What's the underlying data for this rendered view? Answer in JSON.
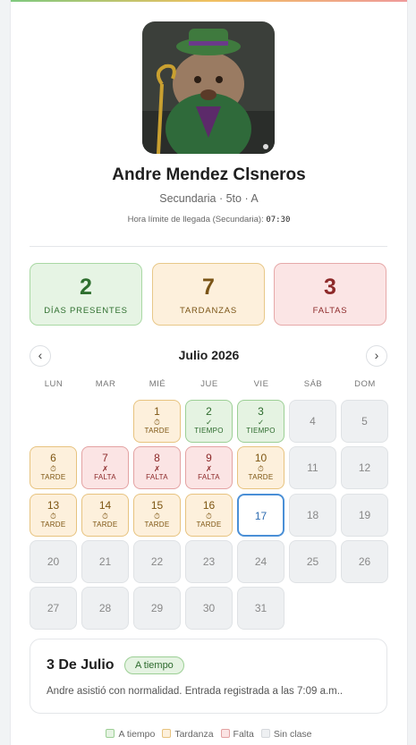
{
  "student": {
    "name": "Andre Mendez Clsneros",
    "info": "Secundaria · 5to · A",
    "limit_label": "Hora límite de llegada (Secundaria):",
    "limit_time": "07:30"
  },
  "stats": [
    {
      "value": "2",
      "label": "DÍAS PRESENTES"
    },
    {
      "value": "7",
      "label": "TARDANZAS"
    },
    {
      "value": "3",
      "label": "FALTAS"
    }
  ],
  "calendar": {
    "month": "Julio 2026",
    "prev_icon": "‹",
    "next_icon": "›",
    "weekdays": [
      "LUN",
      "MAR",
      "MIÉ",
      "JUE",
      "VIE",
      "SÁB",
      "DOM"
    ],
    "days": [
      {
        "n": "1",
        "status": "orange",
        "icon": "⏱",
        "label": "TARDE"
      },
      {
        "n": "2",
        "status": "green",
        "icon": "✓",
        "label": "TIEMPO"
      },
      {
        "n": "3",
        "status": "green",
        "icon": "✓",
        "label": "TIEMPO"
      },
      {
        "n": "4",
        "status": "none"
      },
      {
        "n": "5",
        "status": "none"
      },
      {
        "n": "6",
        "status": "orange",
        "icon": "⏱",
        "label": "TARDE"
      },
      {
        "n": "7",
        "status": "red",
        "icon": "✗",
        "label": "FALTA"
      },
      {
        "n": "8",
        "status": "red",
        "icon": "✗",
        "label": "FALTA"
      },
      {
        "n": "9",
        "status": "red",
        "icon": "✗",
        "label": "FALTA"
      },
      {
        "n": "10",
        "status": "orange",
        "icon": "⏱",
        "label": "TARDE"
      },
      {
        "n": "11",
        "status": "none"
      },
      {
        "n": "12",
        "status": "none"
      },
      {
        "n": "13",
        "status": "orange",
        "icon": "⏱",
        "label": "TARDE"
      },
      {
        "n": "14",
        "status": "orange",
        "icon": "⏱",
        "label": "TARDE"
      },
      {
        "n": "15",
        "status": "orange",
        "icon": "⏱",
        "label": "TARDE"
      },
      {
        "n": "16",
        "status": "orange",
        "icon": "⏱",
        "label": "TARDE"
      },
      {
        "n": "17",
        "status": "today"
      },
      {
        "n": "18",
        "status": "none"
      },
      {
        "n": "19",
        "status": "none"
      },
      {
        "n": "20",
        "status": "none"
      },
      {
        "n": "21",
        "status": "none"
      },
      {
        "n": "22",
        "status": "none"
      },
      {
        "n": "23",
        "status": "none"
      },
      {
        "n": "24",
        "status": "none"
      },
      {
        "n": "25",
        "status": "none"
      },
      {
        "n": "26",
        "status": "none"
      },
      {
        "n": "27",
        "status": "none"
      },
      {
        "n": "28",
        "status": "none"
      },
      {
        "n": "29",
        "status": "none"
      },
      {
        "n": "30",
        "status": "none"
      },
      {
        "n": "31",
        "status": "none"
      }
    ]
  },
  "detail": {
    "title": "3 De Julio",
    "badge": "A tiempo",
    "text": "Andre asistió con normalidad. Entrada registrada a las 7:09 a.m.."
  },
  "legend": [
    {
      "label": "A tiempo",
      "color": "#9ccf95",
      "fill": "#e5f3e2"
    },
    {
      "label": "Tardanza",
      "color": "#e7c37f",
      "fill": "#fdf0dc"
    },
    {
      "label": "Falta",
      "color": "#e3a2a2",
      "fill": "#fbe4e4"
    },
    {
      "label": "Sin clase",
      "color": "#d5d8dc",
      "fill": "#eef0f2"
    }
  ]
}
